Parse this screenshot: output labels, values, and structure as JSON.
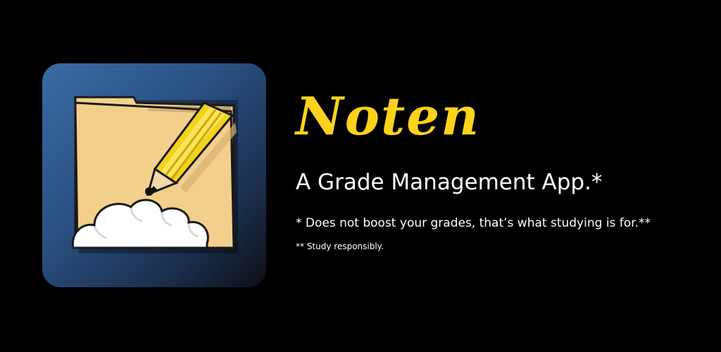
{
  "app": {
    "title": "Noten",
    "tagline": "A Grade Management App.*",
    "footnote_1": "* Does not boost your grades, that’s what studying is for.**",
    "footnote_2": "** Study responsibly."
  },
  "icon": {
    "name": "notebook-pencil-cloud-icon"
  },
  "colors": {
    "background": "#000000",
    "title": "#ffd21c",
    "text": "#ffffff",
    "icon_bg_top": "#3a6ba3",
    "paper": "#f3cf8c",
    "pencil": "#f2d21a"
  }
}
